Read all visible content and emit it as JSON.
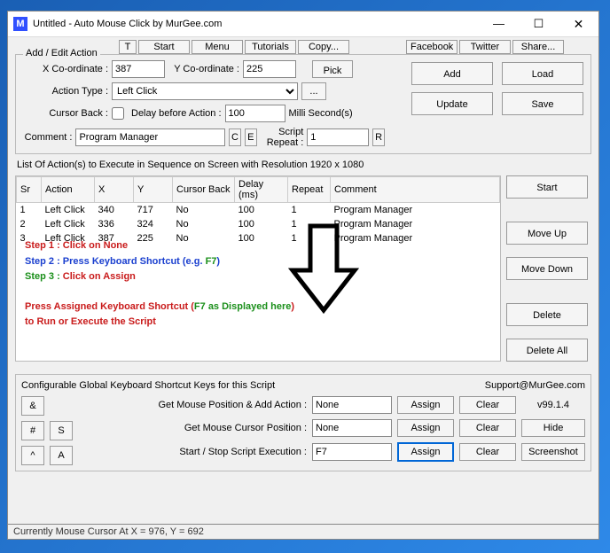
{
  "window": {
    "title": "Untitled - Auto Mouse Click by MurGee.com",
    "min": "—",
    "max": "☐",
    "close": "✕"
  },
  "topbtns": {
    "t": "T",
    "start": "Start",
    "menu": "Menu",
    "tutorials": "Tutorials",
    "copy": "Copy...",
    "facebook": "Facebook",
    "twitter": "Twitter",
    "share": "Share..."
  },
  "addEdit": {
    "legend": "Add / Edit Action",
    "xLabel": "X Co-ordinate :",
    "x": "387",
    "yLabel": "Y Co-ordinate :",
    "y": "225",
    "pick": "Pick",
    "actionTypeLabel": "Action Type :",
    "actionType": "Left Click",
    "more": "...",
    "cursorBackLabel": "Cursor Back :",
    "delayLabel": "Delay before Action :",
    "delay": "100",
    "delayUnit": "Milli Second(s)",
    "commentLabel": "Comment :",
    "comment": "Program Manager",
    "C": "C",
    "E": "E",
    "repeatLabel": "Script Repeat :",
    "repeat": "1",
    "R": "R",
    "add": "Add",
    "load": "Load",
    "update": "Update",
    "save": "Save"
  },
  "listLabel": "List Of Action(s) to Execute in Sequence on Screen with Resolution 1920 x 1080",
  "table": {
    "headers": {
      "sr": "Sr",
      "action": "Action",
      "x": "X",
      "y": "Y",
      "cursorBack": "Cursor Back",
      "delay": "Delay (ms)",
      "repeat": "Repeat",
      "comment": "Comment"
    },
    "rows": [
      {
        "sr": "1",
        "action": "Left Click",
        "x": "340",
        "y": "717",
        "cursorBack": "No",
        "delay": "100",
        "repeat": "1",
        "comment": "Program Manager"
      },
      {
        "sr": "2",
        "action": "Left Click",
        "x": "336",
        "y": "324",
        "cursorBack": "No",
        "delay": "100",
        "repeat": "1",
        "comment": "Program Manager"
      },
      {
        "sr": "3",
        "action": "Left Click",
        "x": "387",
        "y": "225",
        "cursorBack": "No",
        "delay": "100",
        "repeat": "1",
        "comment": "Program Manager"
      }
    ]
  },
  "sideBtns": {
    "start": "Start",
    "moveUp": "Move Up",
    "moveDown": "Move Down",
    "delete": "Delete",
    "deleteAll": "Delete All"
  },
  "overlay": {
    "s1a": "Step 1 : ",
    "s1b": "Click on None",
    "s2a": "Step 2 : ",
    "s2b": "Press Keyboard Shortcut (e.g. ",
    "s2c": "F7",
    "s2d": ")",
    "s3a": "Step 3 : ",
    "s3b": "Click on Assign",
    "l4a": "Press Assigned Keyboard Shortcut (",
    "l4b": "F7 as Displayed here",
    "l4c": ")",
    "l5": "to Run or Execute the Script"
  },
  "shortcuts": {
    "legend": "Configurable Global Keyboard Shortcut Keys for this Script",
    "support": "Support@MurGee.com",
    "r1": {
      "label": "Get Mouse Position & Add Action :",
      "val": "None",
      "assign": "Assign",
      "clear": "Clear",
      "extra": "v99.1.4"
    },
    "r2": {
      "label": "Get Mouse Cursor Position :",
      "val": "None",
      "assign": "Assign",
      "clear": "Clear",
      "extra": "Hide"
    },
    "r3": {
      "label": "Start / Stop Script Execution :",
      "val": "F7",
      "assign": "Assign",
      "clear": "Clear",
      "extra": "Screenshot"
    },
    "keys": {
      "amp": "&",
      "hash": "#",
      "s": "S",
      "caret": "^",
      "a": "A"
    }
  },
  "status": "Currently Mouse Cursor At X = 976, Y = 692"
}
